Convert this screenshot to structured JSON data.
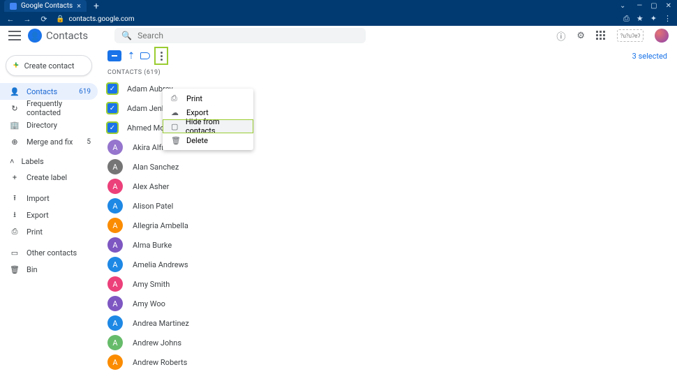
{
  "browser": {
    "tab_title": "Google Contacts",
    "url": "contacts.google.com"
  },
  "header": {
    "app_name": "Contacts",
    "search_placeholder": "Search",
    "alt_chip": "?u?uʔeʔ"
  },
  "sidebar": {
    "create_label": "Create contact",
    "nav": [
      {
        "icon": "👤",
        "label": "Contacts",
        "count": "619",
        "active": true
      },
      {
        "icon": "↻",
        "label": "Frequently contacted",
        "count": "",
        "active": false
      },
      {
        "icon": "🏢",
        "label": "Directory",
        "count": "",
        "active": false
      },
      {
        "icon": "⊕",
        "label": "Merge and fix",
        "count": "5",
        "active": false
      }
    ],
    "labels_heading": "Labels",
    "create_label_text": "Create label",
    "import": "Import",
    "export": "Export",
    "print": "Print",
    "other": "Other contacts",
    "bin": "Bin"
  },
  "toolbar": {
    "selected_text": "3 selected"
  },
  "list_header": "CONTACTS (619)",
  "contacts": [
    {
      "name": "Adam Aubrey",
      "checked": true,
      "color": "#1a73e8"
    },
    {
      "name": "Adam Jenkins",
      "checked": true,
      "color": "#1a73e8"
    },
    {
      "name": "Ahmed Mo",
      "checked": true,
      "color": "#1a73e8"
    },
    {
      "name": "Akira Alfred",
      "checked": false,
      "color": "#9575cd"
    },
    {
      "name": "Alan Sanchez",
      "checked": false,
      "color": "#757575"
    },
    {
      "name": "Alex Asher",
      "checked": false,
      "color": "#ec407a"
    },
    {
      "name": "Alison Patel",
      "checked": false,
      "color": "#1e88e5"
    },
    {
      "name": "Allegria Ambella",
      "checked": false,
      "color": "#fb8c00"
    },
    {
      "name": "Alma Burke",
      "checked": false,
      "color": "#7e57c2"
    },
    {
      "name": "Amelia Andrews",
      "checked": false,
      "color": "#1e88e5"
    },
    {
      "name": "Amy Smith",
      "checked": false,
      "color": "#ec407a"
    },
    {
      "name": "Amy Woo",
      "checked": false,
      "color": "#7e57c2"
    },
    {
      "name": "Andrea Martinez",
      "checked": false,
      "color": "#1e88e5"
    },
    {
      "name": "Andrew Johns",
      "checked": false,
      "color": "#66bb6a"
    },
    {
      "name": "Andrew Roberts",
      "checked": false,
      "color": "#fb8c00"
    }
  ],
  "menu": {
    "print": "Print",
    "export": "Export",
    "hide": "Hide from contacts",
    "delete": "Delete"
  }
}
